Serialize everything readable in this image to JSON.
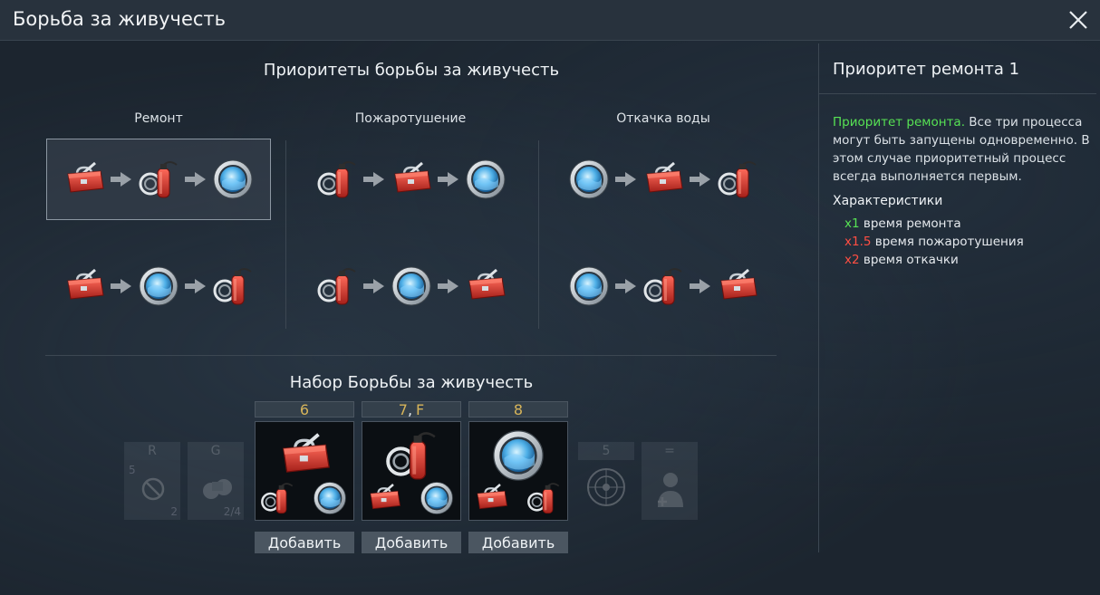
{
  "window": {
    "title": "Борьба за живучесть",
    "close_icon": "close-icon"
  },
  "priorities": {
    "title": "Приоритеты борьбы за живучесть",
    "columns": [
      {
        "label": "Ремонт",
        "chains": [
          [
            "toolbox",
            "extinguisher",
            "porthole"
          ],
          [
            "toolbox",
            "porthole",
            "extinguisher"
          ]
        ]
      },
      {
        "label": "Пожаротушение",
        "chains": [
          [
            "extinguisher",
            "toolbox",
            "porthole"
          ],
          [
            "extinguisher",
            "porthole",
            "toolbox"
          ]
        ]
      },
      {
        "label": "Откачка воды",
        "chains": [
          [
            "porthole",
            "toolbox",
            "extinguisher"
          ],
          [
            "porthole",
            "extinguisher",
            "toolbox"
          ]
        ]
      }
    ],
    "selected": "column 1, chain 1"
  },
  "kit": {
    "title": "Набор Борьбы за живучесть",
    "ghost_slots": [
      {
        "key": "R",
        "tl": "5",
        "br": "2",
        "icon": "no-entry-icon"
      },
      {
        "key": "G",
        "tl": "",
        "br": "2/4",
        "icon": "binoculars-icon"
      },
      {
        "key": "5",
        "tl": "",
        "br": "",
        "icon": "radar-icon"
      },
      {
        "key": "=",
        "tl": "",
        "br": "",
        "icon": "crew-icon"
      }
    ],
    "cards": [
      {
        "key_main": "6",
        "key_sep": "",
        "key_extra": "",
        "big": "toolbox",
        "small": [
          "extinguisher",
          "porthole"
        ],
        "button": "Добавить"
      },
      {
        "key_main": "7",
        "key_sep": ",",
        "key_extra": "F",
        "big": "extinguisher",
        "small": [
          "toolbox",
          "porthole"
        ],
        "button": "Добавить"
      },
      {
        "key_main": "8",
        "key_sep": "",
        "key_extra": "",
        "big": "porthole",
        "small": [
          "toolbox",
          "extinguisher"
        ],
        "button": "Добавить"
      }
    ]
  },
  "info": {
    "title": "Приоритет ремонта 1",
    "highlight": "Приоритет ремонта.",
    "description": " Все три процесса могут быть запущены одновременно. В этом случае приоритетный процесс всегда выполняется первым.",
    "characteristics_title": "Характеристики",
    "stats": [
      {
        "mult": "x1",
        "label": "время ремонта",
        "color": "#57e254"
      },
      {
        "mult": "x1.5",
        "label": "время пожаротушения",
        "color": "#ff4e43"
      },
      {
        "mult": "x2",
        "label": "время откачки",
        "color": "#ff4e43"
      }
    ]
  },
  "colors": {
    "accent_green": "#57e254",
    "accent_red": "#ff4e43",
    "key_gold": "#d6b45a"
  }
}
